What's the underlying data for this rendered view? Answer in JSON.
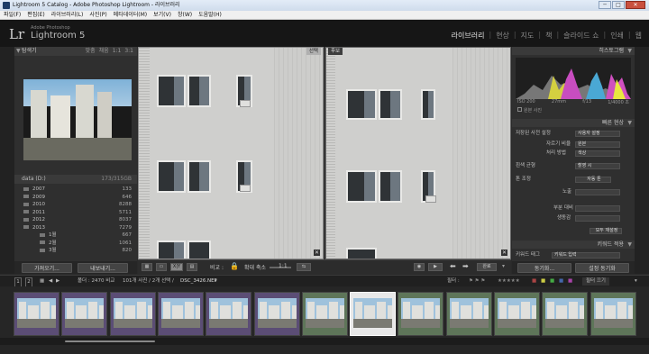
{
  "window": {
    "title": "Lightroom 5 Catalog - Adobe Photoshop Lightroom - 라이브러리",
    "min": "─",
    "max": "□",
    "close": "✕"
  },
  "menu": [
    "파일(F)",
    "편집(E)",
    "라이브러리(L)",
    "사진(P)",
    "메타데이터(M)",
    "보기(V)",
    "창(W)",
    "도움말(H)"
  ],
  "identity": {
    "logo": "Lr",
    "small": "Adobe Photoshop",
    "name": "Lightroom 5",
    "modules": [
      "라이브러리",
      "현상",
      "지도",
      "책",
      "슬라이드 쇼",
      "인쇄",
      "웹"
    ],
    "active_module": "라이브러리"
  },
  "navigator": {
    "title": "탐색기",
    "options": [
      "맞춤",
      "채움",
      "1:1",
      "3:1"
    ]
  },
  "catalog": {
    "label": "data (D:)",
    "count": "173/315GB"
  },
  "folders": [
    {
      "name": "2007",
      "count": "133",
      "sub": false
    },
    {
      "name": "2009",
      "count": "646",
      "sub": false
    },
    {
      "name": "2010",
      "count": "8288",
      "sub": false
    },
    {
      "name": "2011",
      "count": "5711",
      "sub": false
    },
    {
      "name": "2012",
      "count": "8037",
      "sub": false
    },
    {
      "name": "2013",
      "count": "7279",
      "sub": false
    },
    {
      "name": "1월",
      "count": "667",
      "sub": true
    },
    {
      "name": "2월",
      "count": "1061",
      "sub": true
    },
    {
      "name": "3월",
      "count": "820",
      "sub": true
    }
  ],
  "left_buttons": {
    "import": "가져오기...",
    "export": "내보내기..."
  },
  "compare": {
    "select_tag": "선택",
    "candidate_tag": "후보"
  },
  "toolbar": {
    "compare_label": "비교 :",
    "zoom_label": "확대 축소",
    "zoom_value": "1:1",
    "done": "완료",
    "xy": "X|Y"
  },
  "histogram": {
    "title": "히스토그램",
    "iso": "ISO 200",
    "focal": "27mm",
    "aperture": "f/13",
    "shutter": "1/4000 초",
    "original": "원본 사진"
  },
  "quick_develop": {
    "title": "빠른 현상",
    "preset_label": "저장된 사전 설정",
    "preset_value": "사용자 설정",
    "crop_label": "자르기 비율",
    "crop_value": "원본",
    "treatment_label": "처리 방법",
    "treatment_value": "색상",
    "wb_label": "흰색 균형",
    "wb_value": "촬영 시",
    "tone_label": "톤 조정",
    "tone_value": "자동 톤",
    "exposure": "노출",
    "clarity": "부분 대비",
    "vibrance": "생동감",
    "reset": "모두 재설정"
  },
  "keywording": {
    "title": "키워드 적용",
    "tags_label": "키워드 태그",
    "tags_value": "키워드 입력",
    "sync_meta": "동기화...",
    "sync_settings": "설정 동기화"
  },
  "filmstrip_bar": {
    "page1": "1",
    "page2": "2",
    "source": "폴더 : 2470 비교",
    "count": "101개 사진 / 2개 선택 /",
    "filename": "DSC_3426.NEF",
    "filter_label": "필터 :",
    "filter_value": "필터 끄기"
  },
  "colors": {
    "accent": "#cfcfcf",
    "bg": "#2a2a2a",
    "purple": "#5b4d75",
    "green": "#5e7559"
  }
}
